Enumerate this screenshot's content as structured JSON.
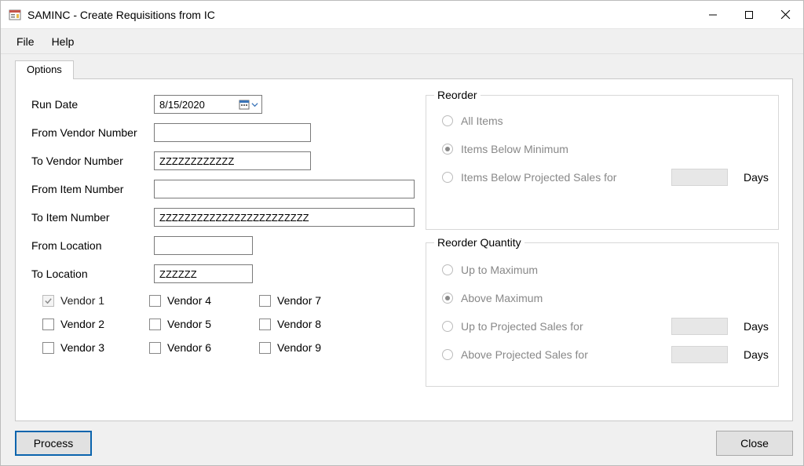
{
  "window": {
    "title": "SAMINC - Create Requisitions from IC"
  },
  "menu": {
    "file": "File",
    "help": "Help"
  },
  "tabs": {
    "options": "Options"
  },
  "form": {
    "run_date_label": "Run Date",
    "run_date_value": "8/15/2020",
    "from_vendor_label": "From Vendor Number",
    "from_vendor_value": "",
    "to_vendor_label": "To Vendor Number",
    "to_vendor_value": "ZZZZZZZZZZZZ",
    "from_item_label": "From Item Number",
    "from_item_value": "",
    "to_item_label": "To Item Number",
    "to_item_value": "ZZZZZZZZZZZZZZZZZZZZZZZZ",
    "from_location_label": "From Location",
    "from_location_value": "",
    "to_location_label": "To Location",
    "to_location_value": "ZZZZZZ"
  },
  "vendors": {
    "v1": "Vendor 1",
    "v2": "Vendor 2",
    "v3": "Vendor 3",
    "v4": "Vendor 4",
    "v5": "Vendor 5",
    "v6": "Vendor 6",
    "v7": "Vendor 7",
    "v8": "Vendor 8",
    "v9": "Vendor 9"
  },
  "reorder": {
    "legend": "Reorder",
    "all_items": "All Items",
    "below_min": "Items Below Minimum",
    "below_projected": "Items Below Projected Sales for",
    "days": "Days"
  },
  "reorder_qty": {
    "legend": "Reorder Quantity",
    "up_to_max": "Up to Maximum",
    "above_max": "Above Maximum",
    "up_to_projected": "Up to Projected Sales for",
    "above_projected": "Above Projected Sales for",
    "days": "Days"
  },
  "buttons": {
    "process": "Process",
    "close": "Close"
  }
}
